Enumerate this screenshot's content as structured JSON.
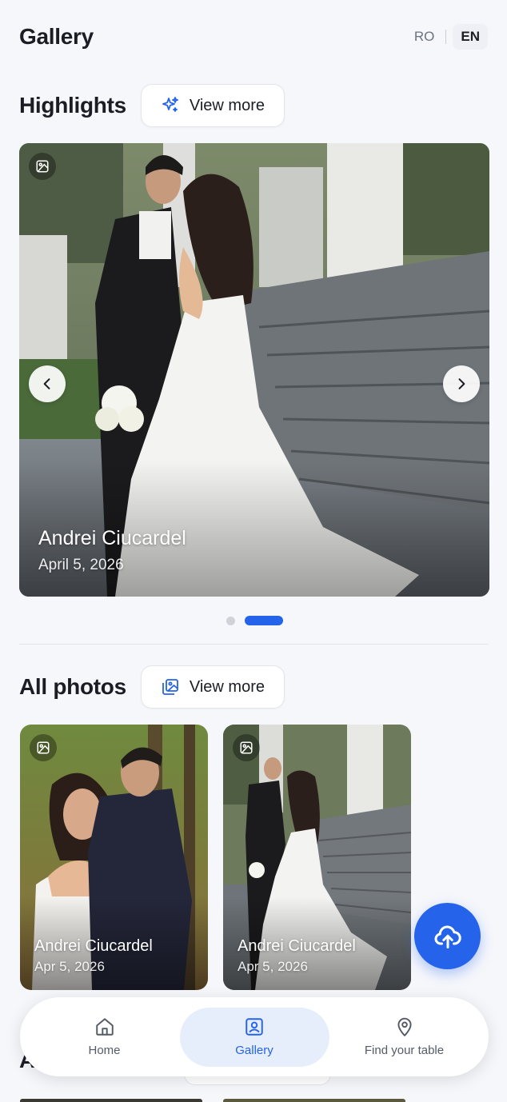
{
  "header": {
    "title": "Gallery",
    "lang_ro": "RO",
    "lang_en": "EN",
    "active_lang": "EN"
  },
  "highlights": {
    "title": "Highlights",
    "view_more_label": "View more",
    "slide": {
      "name": "Andrei Ciucardel",
      "date": "April 5, 2026"
    },
    "slide_count": 2,
    "active_slide": 2
  },
  "all_photos": {
    "title": "All photos",
    "view_more_label": "View more",
    "items": [
      {
        "name": "Andrei Ciucardel",
        "date": "Apr 5, 2026"
      },
      {
        "name": "Andrei Ciucardel",
        "date": "Apr 5, 2026"
      }
    ]
  },
  "next_section_initial": "A",
  "bottom_nav": {
    "items": [
      {
        "label": "Home",
        "icon": "home-icon"
      },
      {
        "label": "Gallery",
        "icon": "gallery-icon"
      },
      {
        "label": "Find your table",
        "icon": "location-pin-icon"
      }
    ],
    "active": "Gallery"
  },
  "colors": {
    "accent": "#2563eb",
    "background": "#f6f7fb",
    "active_nav_bg": "#e6eefc"
  }
}
